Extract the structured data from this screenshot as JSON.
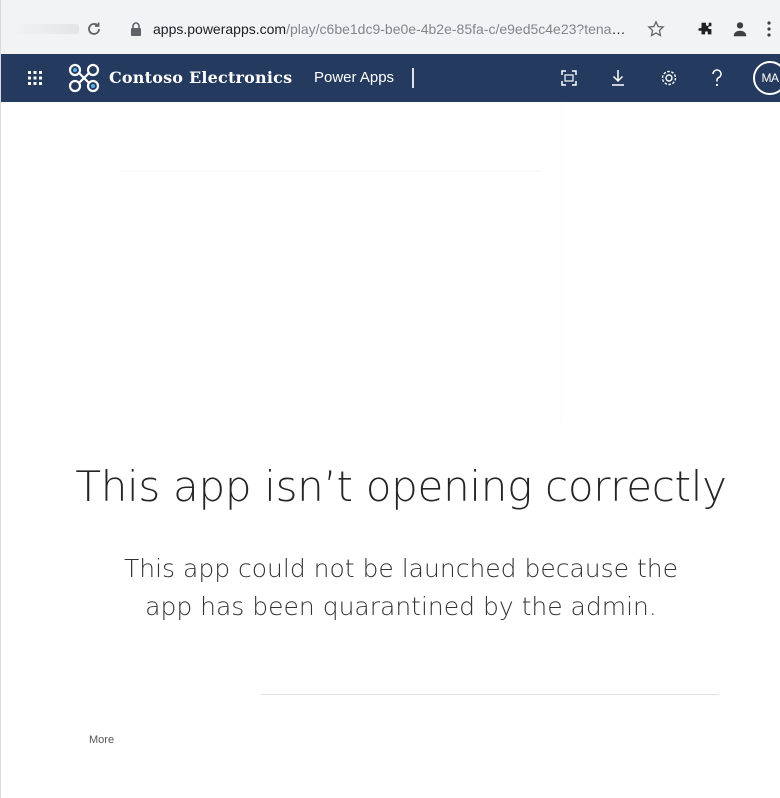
{
  "browser": {
    "url_host": "apps.powerapps.com",
    "url_path": "/play/c6be1dc9-be0e-4b2e-85fa-c/e9ed5c4e23?tenant...",
    "icons": [
      "reload-icon",
      "lock-icon",
      "star-icon",
      "extensions-icon",
      "profile-icon",
      "kebab-menu-icon"
    ]
  },
  "header": {
    "brand_name": "Contoso Electronics",
    "app_name": "Power Apps",
    "avatar_initials": "MA",
    "background_color": "#243a5e",
    "icons": [
      "waffle-icon",
      "contoso-logo-icon",
      "fullscreen-icon",
      "download-icon",
      "settings-icon",
      "help-icon"
    ]
  },
  "error": {
    "title": "This app isn’t opening correctly",
    "message_line1": "This app could not be launched because the",
    "message_line2": "app has been quarantined by the admin.",
    "more_label": "More"
  }
}
